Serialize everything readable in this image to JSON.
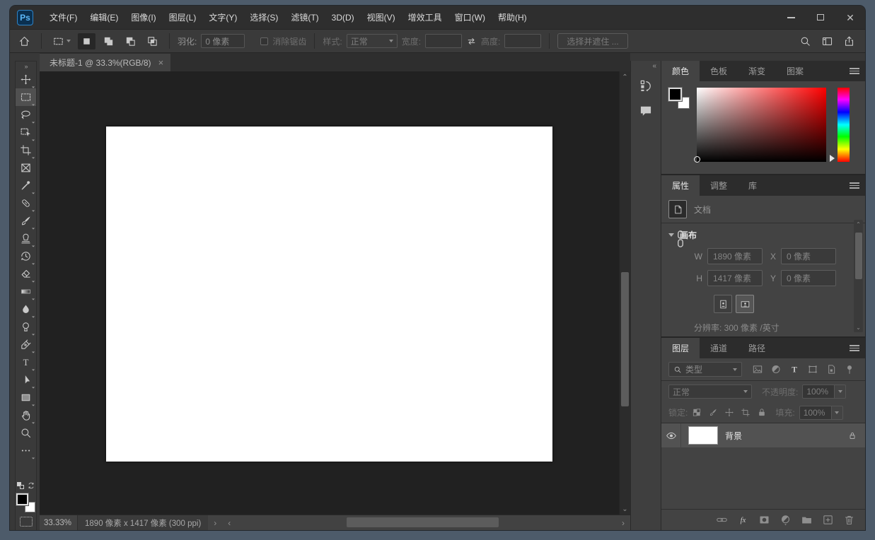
{
  "window": {
    "controls": {
      "minimize": "minimize",
      "maximize": "maximize",
      "close": "close"
    }
  },
  "menu_bar": {
    "logo": "Ps",
    "items": [
      "文件(F)",
      "编辑(E)",
      "图像(I)",
      "图层(L)",
      "文字(Y)",
      "选择(S)",
      "滤镜(T)",
      "3D(D)",
      "视图(V)",
      "增效工具",
      "窗口(W)",
      "帮助(H)"
    ]
  },
  "options_bar": {
    "feather_label": "羽化:",
    "feather_value": "0 像素",
    "antialias_label": "消除锯齿",
    "style_label": "样式:",
    "style_value": "正常",
    "width_label": "宽度:",
    "width_value": "",
    "height_label": "高度:",
    "height_value": "",
    "select_and_mask_label": "选择并遮住 ..."
  },
  "document": {
    "tab_title": "未标题-1 @ 33.3%(RGB/8)",
    "close_glyph": "×"
  },
  "toolbar_icons": [
    "move-tool-icon",
    "rectangular-marquee-icon",
    "lasso-icon",
    "object-selection-icon",
    "crop-icon",
    "frame-icon",
    "eyedropper-icon",
    "healing-brush-icon",
    "brush-icon",
    "clone-stamp-icon",
    "history-brush-icon",
    "eraser-icon",
    "gradient-icon",
    "blur-icon",
    "dodge-icon",
    "pen-icon",
    "type-icon",
    "path-selection-icon",
    "rectangle-icon",
    "hand-icon",
    "zoom-icon",
    "ellipsis-icon"
  ],
  "panels": {
    "color": {
      "tabs": [
        "颜色",
        "色板",
        "渐变",
        "图案"
      ],
      "active_tab": "颜色"
    },
    "properties": {
      "tabs": [
        "属性",
        "调整",
        "库"
      ],
      "active_tab": "属性",
      "document_label": "文档",
      "section_title": "画布",
      "w_label": "W",
      "w_value": "1890 像素",
      "x_label": "X",
      "x_value": "0 像素",
      "h_label": "H",
      "h_value": "1417 像素",
      "y_label": "Y",
      "y_value": "0 像素",
      "resolution": "分辨率: 300 像素 /英寸"
    },
    "layers": {
      "tabs": [
        "图层",
        "通道",
        "路径"
      ],
      "active_tab": "图层",
      "filter_placeholder": "类型",
      "blend_mode": "正常",
      "opacity_label": "不透明度:",
      "opacity_value": "100%",
      "lock_label": "锁定:",
      "fill_label": "填充:",
      "fill_value": "100%",
      "layers": [
        {
          "name": "背景",
          "visible": true,
          "locked": true
        }
      ]
    }
  },
  "status_bar": {
    "zoom_level": "33.33%",
    "doc_info": "1890 像素 x 1417 像素 (300 ppi)"
  }
}
